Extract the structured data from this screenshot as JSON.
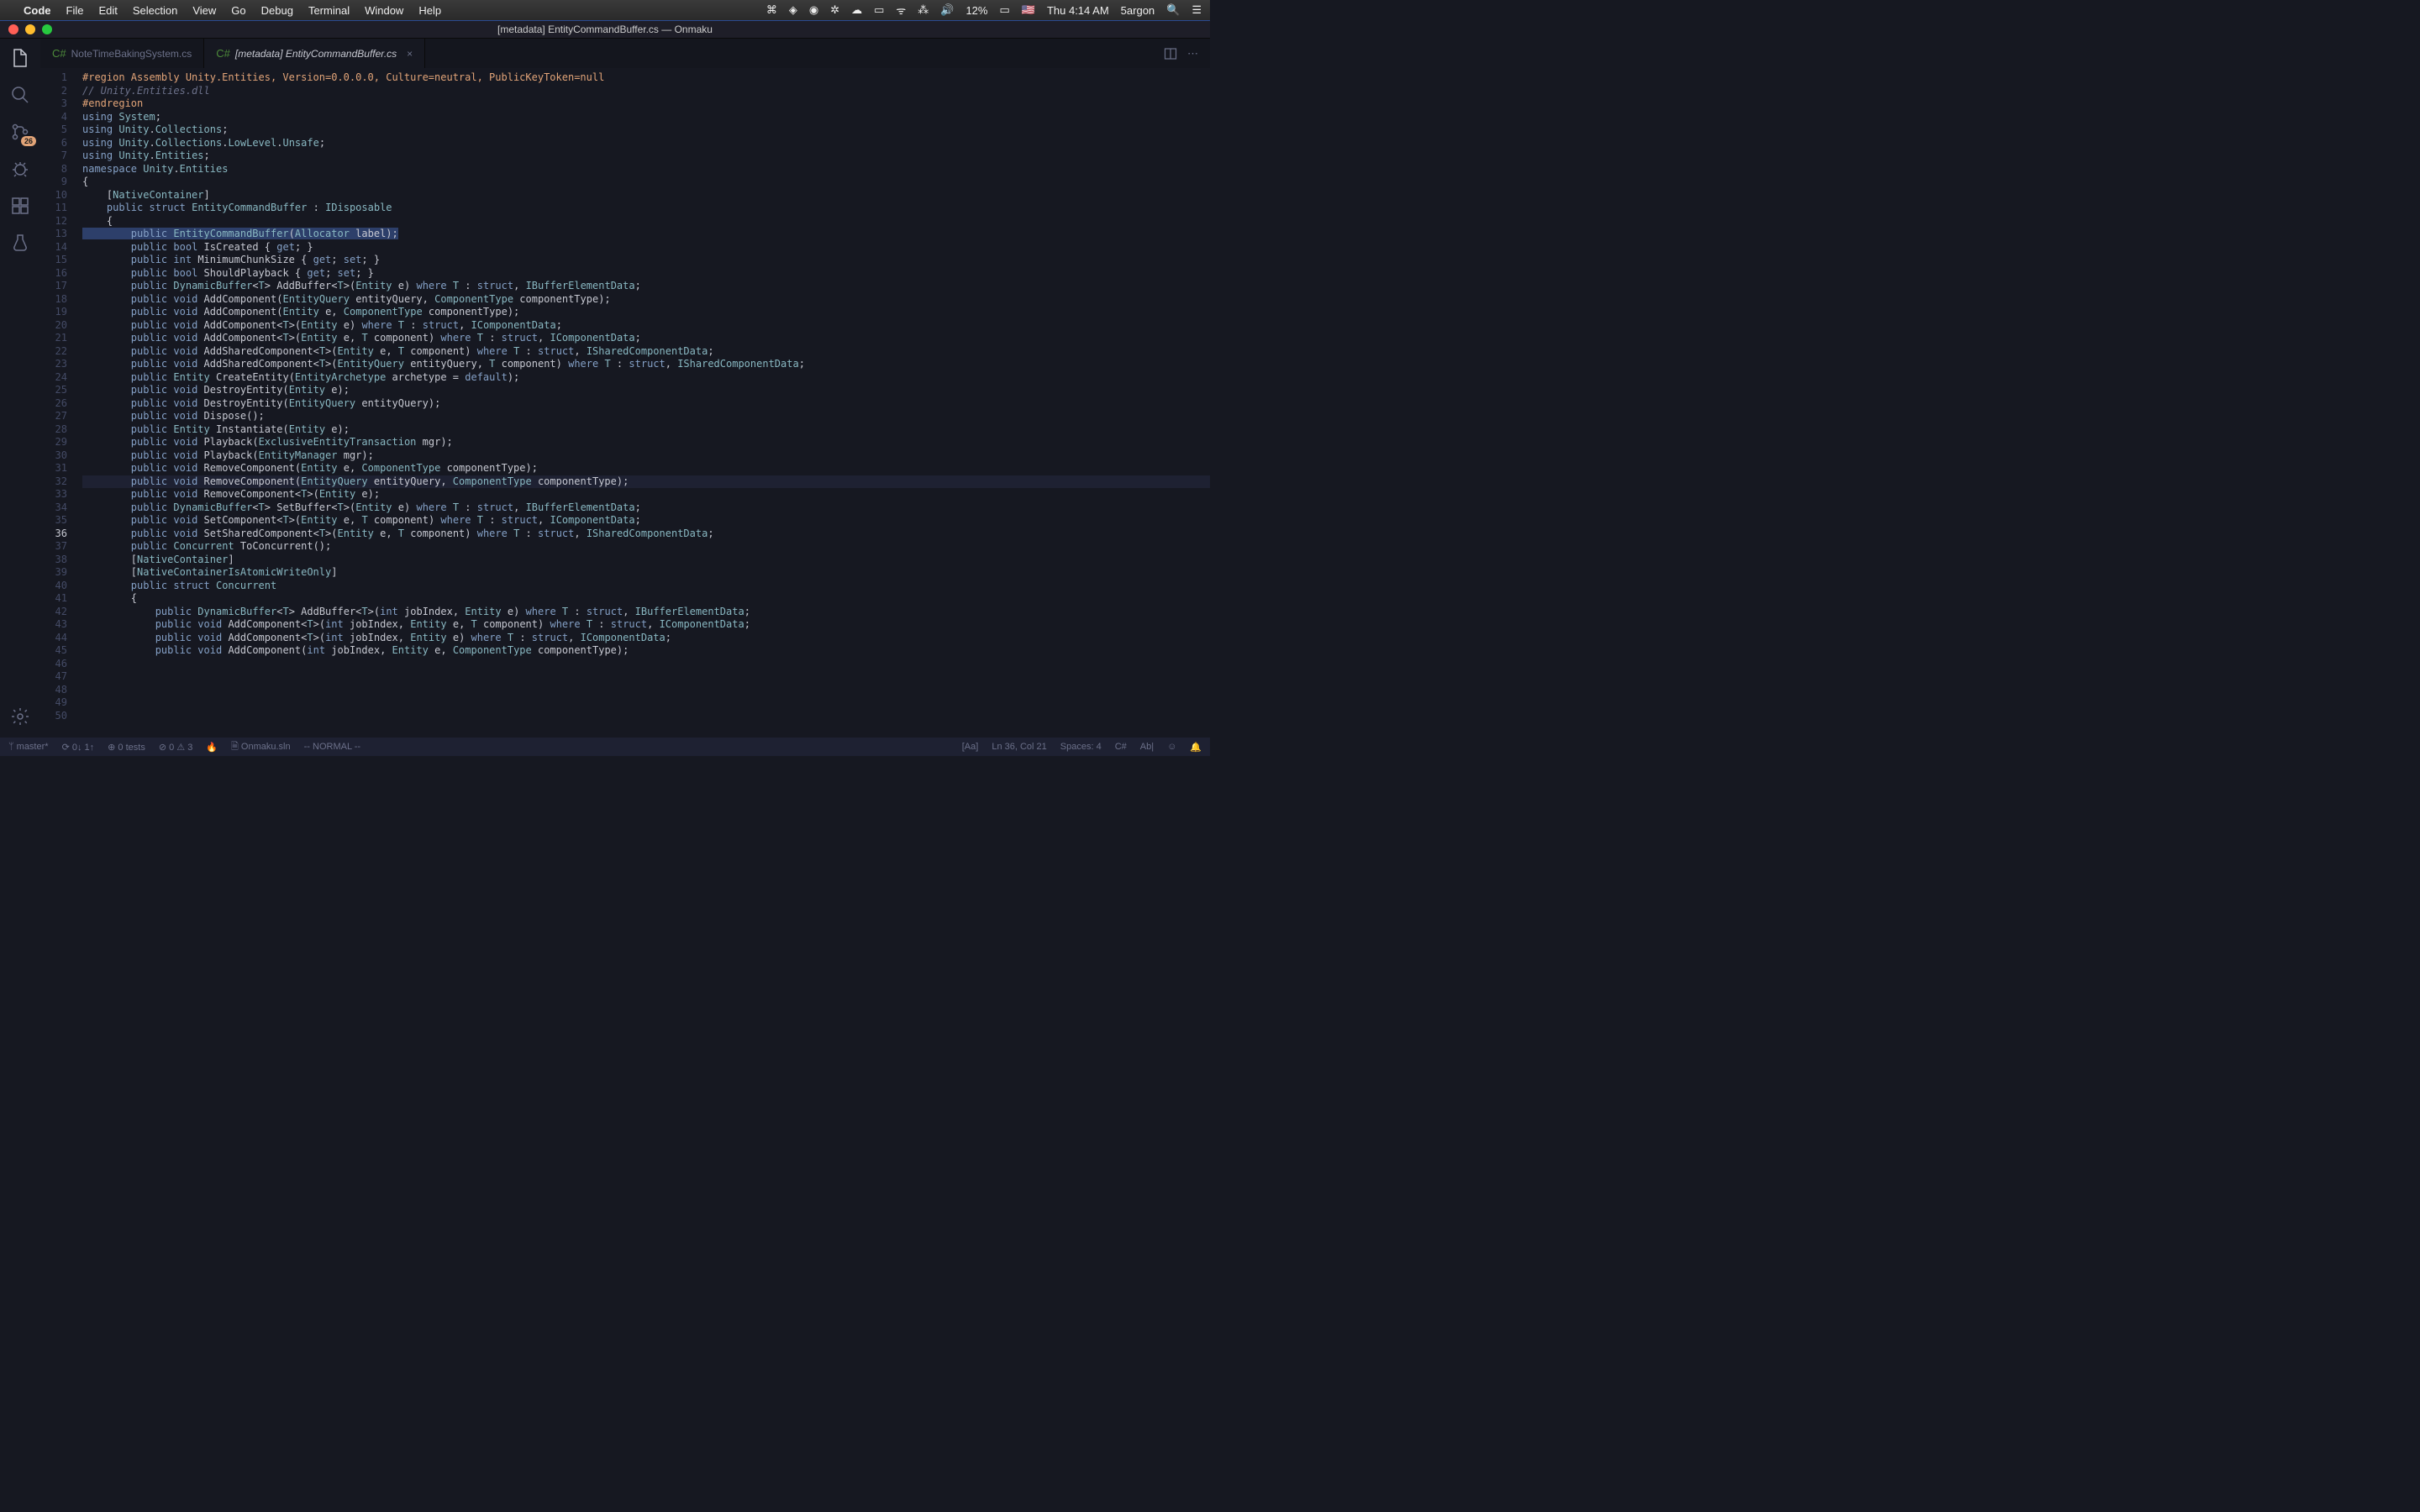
{
  "macbar": {
    "app": "Code",
    "menus": [
      "File",
      "Edit",
      "Selection",
      "View",
      "Go",
      "Debug",
      "Terminal",
      "Window",
      "Help"
    ],
    "battery": "12%",
    "clock": "Thu 4:14 AM",
    "user": "5argon"
  },
  "title": "[metadata] EntityCommandBuffer.cs — Onmaku",
  "activity": {
    "badge": "26"
  },
  "tabs": [
    {
      "label": "NoteTimeBakingSystem.cs",
      "active": false
    },
    {
      "label": "[metadata] EntityCommandBuffer.cs",
      "active": true
    }
  ],
  "code_lines": [
    "#region Assembly Unity.Entities, Version=0.0.0.0, Culture=neutral, PublicKeyToken=null",
    "// Unity.Entities.dll",
    "#endregion",
    "",
    "using System;",
    "using Unity.Collections;",
    "using Unity.Collections.LowLevel.Unsafe;",
    "using Unity.Entities;",
    "",
    "namespace Unity.Entities",
    "{",
    "    [NativeContainer]",
    "    public struct EntityCommandBuffer : IDisposable",
    "    {",
    "        public EntityCommandBuffer(Allocator label);",
    "",
    "        public bool IsCreated { get; }",
    "        public int MinimumChunkSize { get; set; }",
    "        public bool ShouldPlayback { get; set; }",
    "",
    "        public DynamicBuffer<T> AddBuffer<T>(Entity e) where T : struct, IBufferElementData;",
    "        public void AddComponent(EntityQuery entityQuery, ComponentType componentType);",
    "        public void AddComponent(Entity e, ComponentType componentType);",
    "        public void AddComponent<T>(Entity e) where T : struct, IComponentData;",
    "        public void AddComponent<T>(Entity e, T component) where T : struct, IComponentData;",
    "        public void AddSharedComponent<T>(Entity e, T component) where T : struct, ISharedComponentData;",
    "        public void AddSharedComponent<T>(EntityQuery entityQuery, T component) where T : struct, ISharedComponentData;",
    "        public Entity CreateEntity(EntityArchetype archetype = default);",
    "        public void DestroyEntity(Entity e);",
    "        public void DestroyEntity(EntityQuery entityQuery);",
    "        public void Dispose();",
    "        public Entity Instantiate(Entity e);",
    "        public void Playback(ExclusiveEntityTransaction mgr);",
    "        public void Playback(EntityManager mgr);",
    "        public void RemoveComponent(Entity e, ComponentType componentType);",
    "        public void RemoveComponent(EntityQuery entityQuery, ComponentType componentType);",
    "        public void RemoveComponent<T>(Entity e);",
    "        public DynamicBuffer<T> SetBuffer<T>(Entity e) where T : struct, IBufferElementData;",
    "        public void SetComponent<T>(Entity e, T component) where T : struct, IComponentData;",
    "        public void SetSharedComponent<T>(Entity e, T component) where T : struct, ISharedComponentData;",
    "        public Concurrent ToConcurrent();",
    "",
    "        [NativeContainer]",
    "        [NativeContainerIsAtomicWriteOnly]",
    "        public struct Concurrent",
    "        {",
    "            public DynamicBuffer<T> AddBuffer<T>(int jobIndex, Entity e) where T : struct, IBufferElementData;",
    "            public void AddComponent<T>(int jobIndex, Entity e, T component) where T : struct, IComponentData;",
    "            public void AddComponent<T>(int jobIndex, Entity e) where T : struct, IComponentData;",
    "            public void AddComponent(int jobIndex, Entity e, ComponentType componentType);"
  ],
  "current_line": 36,
  "status": {
    "branch": "master*",
    "sync": "⟳ 0↓ 1↑",
    "tests": "0 tests",
    "problems": "⊘ 0 ⚠ 3",
    "solution": "Onmaku.sln",
    "vim": "-- NORMAL --",
    "pos": "Ln 36, Col 21",
    "spaces": "Spaces: 4",
    "lang": "C#",
    "ab": "Ab|",
    "bell": "🔔"
  }
}
